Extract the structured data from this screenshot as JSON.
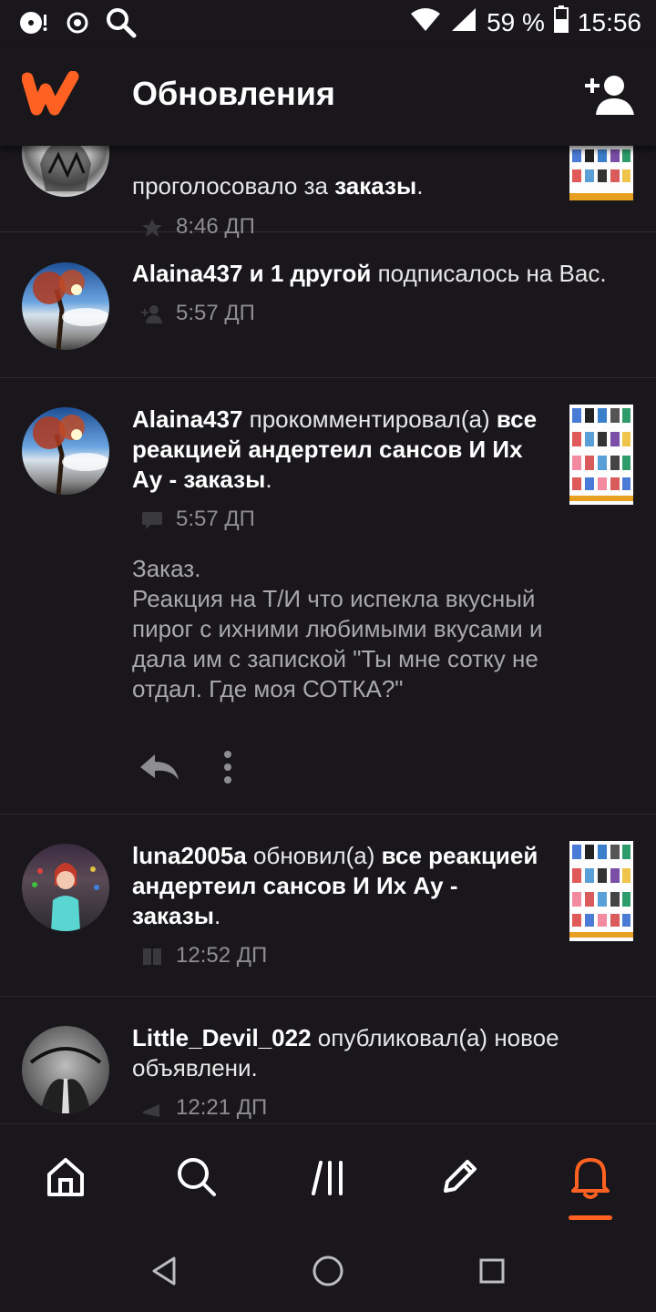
{
  "status_bar": {
    "battery": "59 %",
    "time": "15:56"
  },
  "header": {
    "title": "Обновления"
  },
  "feed": [
    {
      "parts": [
        "",
        "проголосовало за ",
        "заказы",
        "."
      ],
      "time": "8:46 ДП",
      "meta_icon": "star-icon"
    },
    {
      "parts": [
        "Alaina437 и 1 другой",
        " подписалось на Вас.",
        "",
        ""
      ],
      "time": "5:57 ДП",
      "meta_icon": "follow-icon"
    },
    {
      "parts": [
        "Alaina437",
        " прокомментировал(а) ",
        "все реакцией андертеил сансов И Их Ау - заказы",
        "."
      ],
      "time": "5:57 ДП",
      "meta_icon": "comment-icon",
      "comment": "Заказ.\nРеакция на Т/И что испекла вкусный пирог с ихними любимыми вкусами и дала им с запиской \"Ты мне сотку не отдал. Где моя СОТКА?\""
    },
    {
      "parts": [
        "luna2005a",
        " обновил(а) ",
        "все реакцией андертеил сансов И Их Ау - заказы",
        "."
      ],
      "time": "12:52 ДП",
      "meta_icon": "book-icon"
    },
    {
      "parts": [
        "Little_Devil_022",
        " опубликовал(а) новое объявлени.",
        "",
        ""
      ],
      "time": "12:21 ДП",
      "meta_icon": "announcement-icon"
    }
  ],
  "colors": {
    "background": "#19171b",
    "accent": "#ff6122",
    "muted": "#8e8d92",
    "comment": "#a9a8ad"
  }
}
